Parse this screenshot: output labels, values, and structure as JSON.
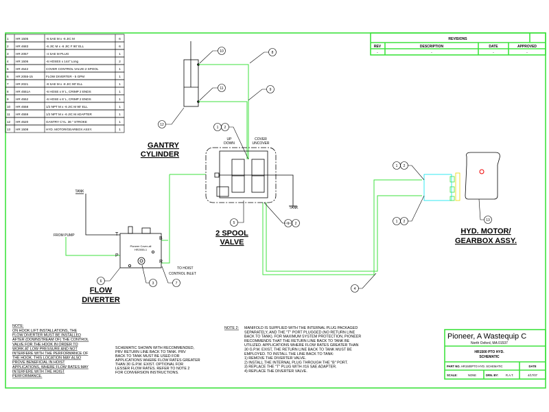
{
  "parts_table": [
    {
      "item": "1",
      "part": "HR 1505",
      "desc": "-6 SAE M x -6 JIC M",
      "qty": "6"
    },
    {
      "item": "2",
      "part": "HR 4683",
      "desc": "-6 JIC M x -6 JIC F 90' ELL",
      "qty": "6"
    },
    {
      "item": "3",
      "part": "HR 2057",
      "desc": "-4 SAE M PLUG",
      "qty": "1"
    },
    {
      "item": "4",
      "part": "HR 1506",
      "desc": "-6 HOSES x 144\" Long",
      "qty": "2"
    },
    {
      "item": "5",
      "part": "HR 4542",
      "desc": "COVER CONTROL VALVE-2 SPOOL",
      "qty": "1"
    },
    {
      "item": "6",
      "part": "HR 2055-15",
      "desc": "FLOW DIVERTER - 5 GPM",
      "qty": "1"
    },
    {
      "item": "7",
      "part": "HR 2021",
      "desc": "-8 SAE M x -8 JIC 90' ELL",
      "qty": "1"
    },
    {
      "item": "8",
      "part": "HR 4551A",
      "desc": "-6 HOSE x 9' L, CRIMP 2 ENDS",
      "qty": "1"
    },
    {
      "item": "9",
      "part": "HR 4552",
      "desc": "-6 HOSE x 6' L, CRIMP 2 ENDS",
      "qty": "1"
    },
    {
      "item": "10",
      "part": "HR 4558",
      "desc": "1/2 NPT M x -6 JIC M 90' ELL",
      "qty": "1"
    },
    {
      "item": "11",
      "part": "HR 4559",
      "desc": "1/2 NPT M x -6 JIC M ADAPTER",
      "qty": "1"
    },
    {
      "item": "12",
      "part": "HR 4520",
      "desc": "GANTRY CYL. 36 \" STROKE",
      "qty": "1"
    },
    {
      "item": "13",
      "part": "HR 1508",
      "desc": "HYD. MOTOR/GEARBOX ASSY.",
      "qty": "1"
    }
  ],
  "revisions": {
    "title": "REVISIONS",
    "headers": [
      "REV",
      "DESCRIPTION",
      "DATE",
      "APPROVED"
    ],
    "row": [
      "-",
      "-",
      "-",
      "-"
    ]
  },
  "labels": {
    "gantry_cylinder": [
      "GANTRY",
      "CYLINDER"
    ],
    "spool_valve": [
      "2 SPOOL",
      "VALVE"
    ],
    "flow_diverter": [
      "FLOW",
      "DIVERTER"
    ],
    "motor": [
      "HYD. MOTOR/",
      "GEARBOX ASSY."
    ],
    "up": "UP",
    "down": "DOWN",
    "cover": "COVER",
    "uncover": "UNCOVER",
    "tank": "TANK",
    "from_pump": "FROM PUMP",
    "to_hoist": [
      "TO HOIST",
      "CONTROL INLET"
    ],
    "port_t": "T",
    "port_p": "P",
    "port_b": "B",
    "port_r": "R",
    "diverter_text": [
      "Pioneer Cover-all",
      "HR2055-1"
    ]
  },
  "balloons": {
    "b1": "1",
    "b2": "2",
    "b3": "3",
    "b4": "4",
    "b5": "5",
    "b6": "6",
    "b7": "7",
    "b8": "8",
    "b9": "9",
    "b10": "10",
    "b11": "11",
    "b12": "12",
    "b13": "13"
  },
  "note1": {
    "title": "NOTE:",
    "lines": [
      "ON HOOK LIFT INSTALLATIONS, THE",
      "FLOW DIVERTER MUST BE INSTALLED",
      "AFTER (DOWNSTREAM OF) THE CONTROL",
      "VALVE FOR THE HOOK IN ORDER TO",
      "WORK AT LOW PRESSURE AND NOT",
      "INTERFERE WITH THE PERFORMANCE OF",
      "THE HOOK. THIS LOCATION MAY ALSO",
      "PROVE BENEFICIAL IN HOIST",
      "APPLICATIONS, WHERE FLOW RATES MAY",
      "INTERFERE WITH THE HOIST",
      "PERFORMANCE."
    ]
  },
  "note_schematic": [
    "SCHEMATIC SHOWN WITH RECOMMENDED,",
    "PRV RETURN LINE BACK TO TANK. PRV",
    "BACK TO TANK MUST BE USED FOR",
    "APPLICATIONS WHERE FLOW RATES GREATER",
    "THAN 30 G.P.M. EXIST. OPTIONAL FOR",
    "LESSER FLOW RATES. REFER TO NOTE 2",
    "FOR CONVERSION INSTRUCTIONS."
  ],
  "note2": {
    "title": "NOTE 2:",
    "lines": [
      "MANIFOLD IS SUPPLIED WITH THE INTERNAL PLUG PACKAGED",
      "SEPARATELY, AND THE \"T\" PORT PLUGGED (NO RETURN LINE",
      "BACK TO TANK). FOR MAXIMUM SYSTEM PROTECTION, PIONEER",
      "RECOMMENDS THAT THE RETURN LINE BACK TO TANK BE",
      "UTILIZED. APPLICATIONS WHERE FLOW RATES GREATER THAN",
      "30 G.P.M. EXIST, THE RETURN LINE BACK TO TANK MUST BE",
      "EMPLOYED. TO INSTALL THE LINE BACK TO TANK:",
      "1)  REMOVE THE DIVERTER VALVE.",
      "2)  INSTALL THE INTERNAL PLUG THROUGH THE \"B\" PORT.",
      "3)  REPLACE THE \"T\" PLUG WITH #16 SAE ADAPTER.",
      "4)  REPLACE THE DIVERTER VALVE."
    ]
  },
  "title_block": {
    "company": "Pioneer, A Wastequip C",
    "address": "North Oxford, MA     01537",
    "title": [
      "HR1500 PTO HYD.",
      "SCHEMATIC"
    ],
    "part_no_label": "PART NO.",
    "part_no": "HR1500PTO HYD. SCHEMATIC",
    "date_label": "DATE",
    "scale_label": "SCALE:",
    "scale": "NONE",
    "drawn_by_label": "DRN. BY:",
    "drawn_by": "R.A.T.",
    "date": "4/17/07"
  },
  "colors": {
    "frame": "#3ee23e",
    "hose": "#3ee23e",
    "fitting": "#00e5ee",
    "line": "#000000"
  }
}
